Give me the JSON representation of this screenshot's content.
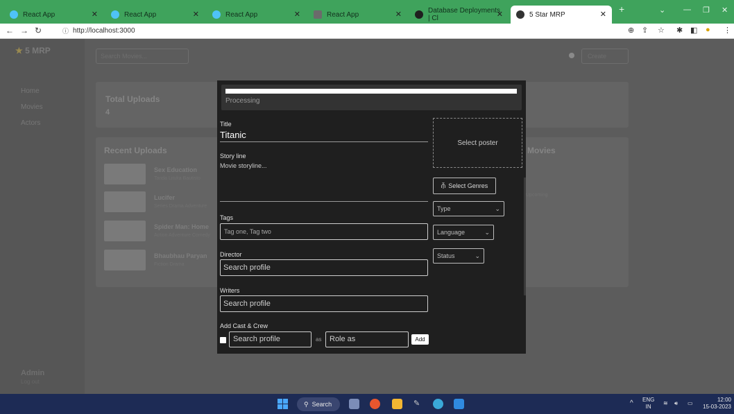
{
  "browser": {
    "tabs": [
      {
        "title": "React App",
        "favicon_color": "#4fc3f7"
      },
      {
        "title": "React App",
        "favicon_color": "#4fc3f7"
      },
      {
        "title": "React App",
        "favicon_color": "#4fc3f7"
      },
      {
        "title": "React App",
        "favicon_color": "#7a7a7a"
      },
      {
        "title": "Database Deployments | Cl",
        "favicon_color": "#2c2c2c"
      },
      {
        "title": "5 Star MRP",
        "favicon_color": "#3a3a3a",
        "active": true
      }
    ],
    "url": "http://localhost:3000",
    "accent": "#3fa35c"
  },
  "app": {
    "logo": "5 MRP",
    "search_placeholder": "Search Movies...",
    "create_label": "Create",
    "nav": [
      "Home",
      "Movies",
      "Actors"
    ],
    "admin_name": "Admin",
    "admin_sub": "Log out",
    "total_uploads_title": "Total Uploads",
    "total_uploads_value": "4",
    "recent_title": "Recent Uploads",
    "recent_items": [
      {
        "title": "Sex Education",
        "sub": "Tanda Lituka Bautisto"
      },
      {
        "title": "Lucifer",
        "sub": "Series Drama Adventure"
      },
      {
        "title": "Spider Man: Home",
        "sub": "Action Adventure Comedy"
      },
      {
        "title": "Bhaubhau Paryan",
        "sub": "Fiction Drama"
      }
    ],
    "most_rated_title": "Movies",
    "most_rated_items": [
      "Upcoming"
    ]
  },
  "modal": {
    "processing_label": "Processing",
    "progress": 0.97,
    "title_label": "Title",
    "title_value": "Titanic",
    "storyline_label": "Story line",
    "storyline_placeholder": "Movie storyline...",
    "tags_label": "Tags",
    "tags_placeholder": "Tag one, Tag two",
    "director_label": "Director",
    "director_placeholder": "Search profile",
    "writers_label": "Writers",
    "writers_placeholder": "Search profile",
    "cast_label": "Add Cast & Crew",
    "cast_placeholder": "Search profile",
    "as_label": "as",
    "role_placeholder": "Role as",
    "add_label": "Add",
    "poster_label": "Select poster",
    "genres_label": "Select Genres",
    "type_label": "Type",
    "language_label": "Language",
    "status_label": "Status"
  },
  "taskbar": {
    "search_label": "Search",
    "lang_top": "ENG",
    "lang_bottom": "IN",
    "time": "12:00",
    "date": "15-03-2023"
  }
}
